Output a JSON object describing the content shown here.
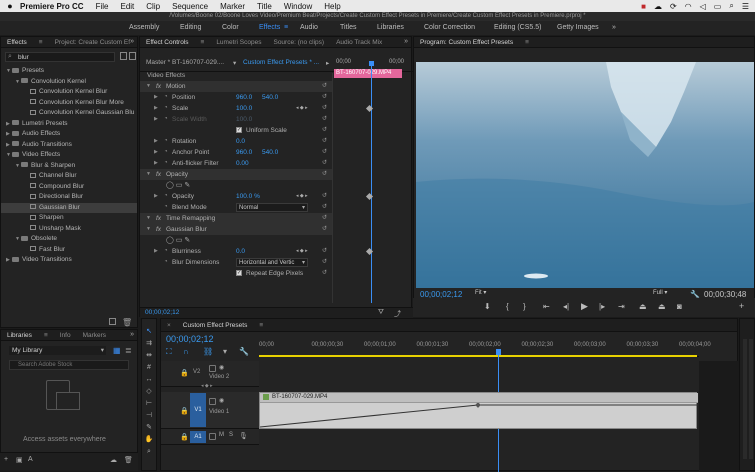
{
  "menubar": {
    "app": "Premiere Pro CC",
    "items": [
      "File",
      "Edit",
      "Clip",
      "Sequence",
      "Marker",
      "Title",
      "Window",
      "Help"
    ]
  },
  "titlebar": {
    "path": "/Volumes/Boone 02/Boone Loves Video/Premium Beat/Projects/Create Custom Effect Presets in Premiere/Create Custom Effect Presets in Premiere.prproj *"
  },
  "workspaces": {
    "items": [
      "Assembly",
      "Editing",
      "Color",
      "Effects",
      "Audio",
      "Titles",
      "Libraries",
      "Color Correction",
      "Editing (CS5.5)",
      "Getty Images"
    ],
    "active": "Effects"
  },
  "effects_panel": {
    "tabs": [
      "Effects",
      "Project: Create Custom Ef"
    ],
    "search_value": "blur",
    "tree": [
      {
        "label": "Presets",
        "level": 0,
        "kind": "folder",
        "open": true
      },
      {
        "label": "Convolution Kernel",
        "level": 1,
        "kind": "folder",
        "open": true
      },
      {
        "label": "Convolution Kernel Blur",
        "level": 2,
        "kind": "fx"
      },
      {
        "label": "Convolution Kernel Blur More",
        "level": 2,
        "kind": "fx"
      },
      {
        "label": "Convolution Kernel Gaussian Blu",
        "level": 2,
        "kind": "fx"
      },
      {
        "label": "Lumetri Presets",
        "level": 0,
        "kind": "folder"
      },
      {
        "label": "Audio Effects",
        "level": 0,
        "kind": "folder"
      },
      {
        "label": "Audio Transitions",
        "level": 0,
        "kind": "folder"
      },
      {
        "label": "Video Effects",
        "level": 0,
        "kind": "folder",
        "open": true
      },
      {
        "label": "Blur & Sharpen",
        "level": 1,
        "kind": "folder",
        "open": true
      },
      {
        "label": "Channel Blur",
        "level": 2,
        "kind": "fx"
      },
      {
        "label": "Compound Blur",
        "level": 2,
        "kind": "fx"
      },
      {
        "label": "Directional Blur",
        "level": 2,
        "kind": "fx"
      },
      {
        "label": "Gaussian Blur",
        "level": 2,
        "kind": "fx",
        "selected": true
      },
      {
        "label": "Sharpen",
        "level": 2,
        "kind": "fx"
      },
      {
        "label": "Unsharp Mask",
        "level": 2,
        "kind": "fx"
      },
      {
        "label": "Obsolete",
        "level": 1,
        "kind": "folder",
        "open": true
      },
      {
        "label": "Fast Blur",
        "level": 2,
        "kind": "fx"
      },
      {
        "label": "Video Transitions",
        "level": 0,
        "kind": "folder"
      }
    ]
  },
  "libraries_panel": {
    "tabs": [
      "Libraries",
      "Info",
      "Markers"
    ],
    "library": "My Library",
    "search_placeholder": "Search Adobe Stock",
    "empty_text": "Access assets everywhere"
  },
  "effect_controls": {
    "tabs": [
      "Effect Controls",
      "Lumetri Scopes",
      "Source: (no clips)",
      "Audio Track Mix"
    ],
    "master": "Master * BT-160707-029....",
    "clip": "Custom Effect Presets * ...",
    "time_start": "00;00",
    "time_end": "00;00",
    "clip_label": "BT-160707-029.MP4",
    "section": "Video Effects",
    "rows": [
      {
        "label": "Motion",
        "type": "fx"
      },
      {
        "label": "Position",
        "v1": "960.0",
        "v2": "540.0"
      },
      {
        "label": "Scale",
        "v1": "100.0",
        "keyframe": true
      },
      {
        "label": "Scale Width",
        "v1": "100.0",
        "disabled": true
      },
      {
        "label": "Uniform Scale",
        "checkbox": true
      },
      {
        "label": "Rotation",
        "v1": "0.0"
      },
      {
        "label": "Anchor Point",
        "v1": "960.0",
        "v2": "540.0"
      },
      {
        "label": "Anti-flicker Filter",
        "v1": "0.00"
      },
      {
        "label": "Opacity",
        "type": "fx"
      },
      {
        "label": "Opacity",
        "v1": "100.0 %",
        "keyframe": true
      },
      {
        "label": "Blend Mode",
        "dropdown": "Normal"
      },
      {
        "label": "Time Remapping",
        "type": "fx"
      },
      {
        "label": "Gaussian Blur",
        "type": "fx"
      },
      {
        "label": "Blurriness",
        "v1": "0.0",
        "keyframe": true
      },
      {
        "label": "Blur Dimensions",
        "dropdown": "Horizontal and Vertic"
      },
      {
        "label": "Repeat Edge Pixels",
        "checkbox": true
      }
    ],
    "timecode": "00;00;02;12"
  },
  "program_monitor": {
    "title": "Program: Custom Effect Presets",
    "timecode": "00;00;02;12",
    "zoom": "Fit",
    "quality": "Full",
    "duration": "00;00;30;48",
    "playhead_fraction": 0.046,
    "colors": {
      "sky": "#8aa7bd",
      "water": "#2f6d96",
      "ice": "#cfe2ef"
    }
  },
  "timeline": {
    "tab": "Custom Effect Presets",
    "timecode": "00;00;02;12",
    "ruler": [
      "00;00",
      "00;00;00;30",
      "00;00;01;00",
      "00;00;01;30",
      "00;00;02;00",
      "00;00;02;30",
      "00;00;03;00",
      "00;00;03;30",
      "00;00;04;00"
    ],
    "tracks": [
      {
        "id": "V2",
        "name": "Video 2"
      },
      {
        "id": "V1",
        "name": "Video 1"
      },
      {
        "id": "A1",
        "name": ""
      }
    ],
    "clip": "BT-160707-029.MP4"
  }
}
